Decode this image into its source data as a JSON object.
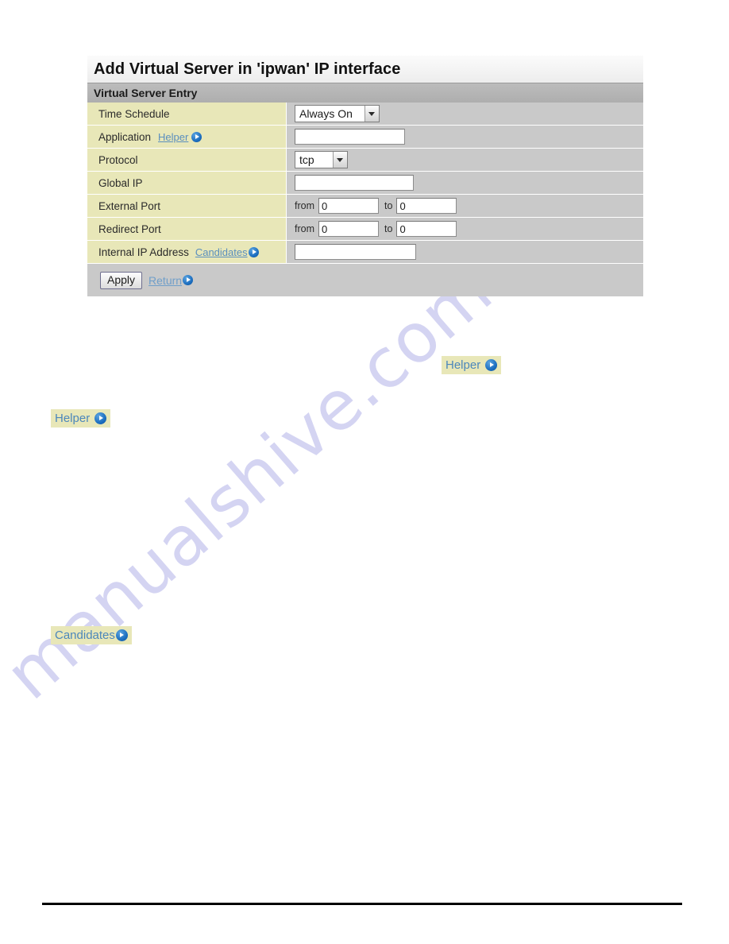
{
  "panel": {
    "title": "Add Virtual Server in 'ipwan' IP interface",
    "subhead": "Virtual Server Entry",
    "rows": [
      {
        "label": "Time Schedule",
        "control": "select",
        "value": "Always On"
      },
      {
        "label": "Application",
        "link": "Helper",
        "control": "text",
        "value": "",
        "placeholder": ""
      },
      {
        "label": "Protocol",
        "control": "select",
        "value": "tcp"
      },
      {
        "label": "Global IP",
        "control": "text",
        "value": "",
        "placeholder": ""
      },
      {
        "label": "External Port",
        "control": "range",
        "from_label": "from",
        "from_value": "0",
        "to_label": "to",
        "to_value": "0"
      },
      {
        "label": "Redirect Port",
        "control": "range",
        "from_label": "from",
        "from_value": "0",
        "to_label": "to",
        "to_value": "0"
      },
      {
        "label": "Internal IP Address",
        "link": "Candidates",
        "control": "text",
        "value": "",
        "placeholder": ""
      }
    ],
    "actions": {
      "apply_label": "Apply",
      "return_label": "Return"
    }
  },
  "callouts": [
    {
      "label": "Helper"
    },
    {
      "label": "Helper"
    },
    {
      "label": "Candidates"
    }
  ],
  "watermark": {
    "text": "manualshive.com"
  },
  "icons": {
    "arrow": "blue-circle-play-icon",
    "chevron": "chevron-down-icon"
  },
  "colors": {
    "label_cell": "#e8e7b8",
    "value_cell": "#c9c9c9",
    "subhead": "#b5b5b5",
    "link": "#5a8fbe",
    "badge_bg": "#e8e7b8",
    "watermark": "#cdcdf0"
  }
}
